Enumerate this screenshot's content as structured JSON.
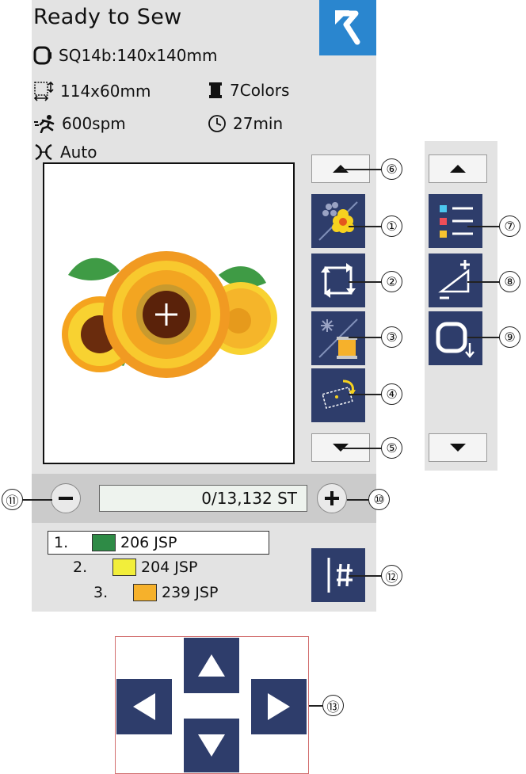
{
  "header": {
    "title": "Ready to Sew"
  },
  "info": {
    "hoop": "SQ14b:140x140mm",
    "size": "114x60mm",
    "colors": "7Colors",
    "speed": "600spm",
    "time": "27min",
    "thread_cutter": "Auto"
  },
  "stitch": {
    "counter": "0/13,132 ST"
  },
  "color_list": [
    {
      "index": "1.",
      "code": "206 JSP",
      "color": "#2e8b46"
    },
    {
      "index": "2.",
      "code": "204 JSP",
      "color": "#f2ee3a"
    },
    {
      "index": "3.",
      "code": "239 JSP",
      "color": "#f6b12b"
    }
  ],
  "callouts": [
    "①",
    "②",
    "③",
    "④",
    "⑤",
    "⑥",
    "⑦",
    "⑧",
    "⑨",
    "⑩",
    "⑪",
    "⑫",
    "⑬"
  ],
  "icons": {
    "back": "return-arrow-icon",
    "color_group": "flower-scissors-icon",
    "trace": "trace-frame-icon",
    "single_color": "spool-cross-icon",
    "rotate": "rotate-hoop-icon",
    "color_list_toggle": "list-icon",
    "tension": "tension-icon",
    "hoop_change": "hoop-icon",
    "thread_number": "needle-hash-icon",
    "jog_up": "arrow-up-icon",
    "jog_left": "arrow-left-icon",
    "jog_right": "arrow-right-icon",
    "jog_down": "arrow-down-icon"
  },
  "theme": {
    "accent": "#2a86cf",
    "button_dark": "#2e3d6b",
    "panel": "#e3e3e3"
  }
}
